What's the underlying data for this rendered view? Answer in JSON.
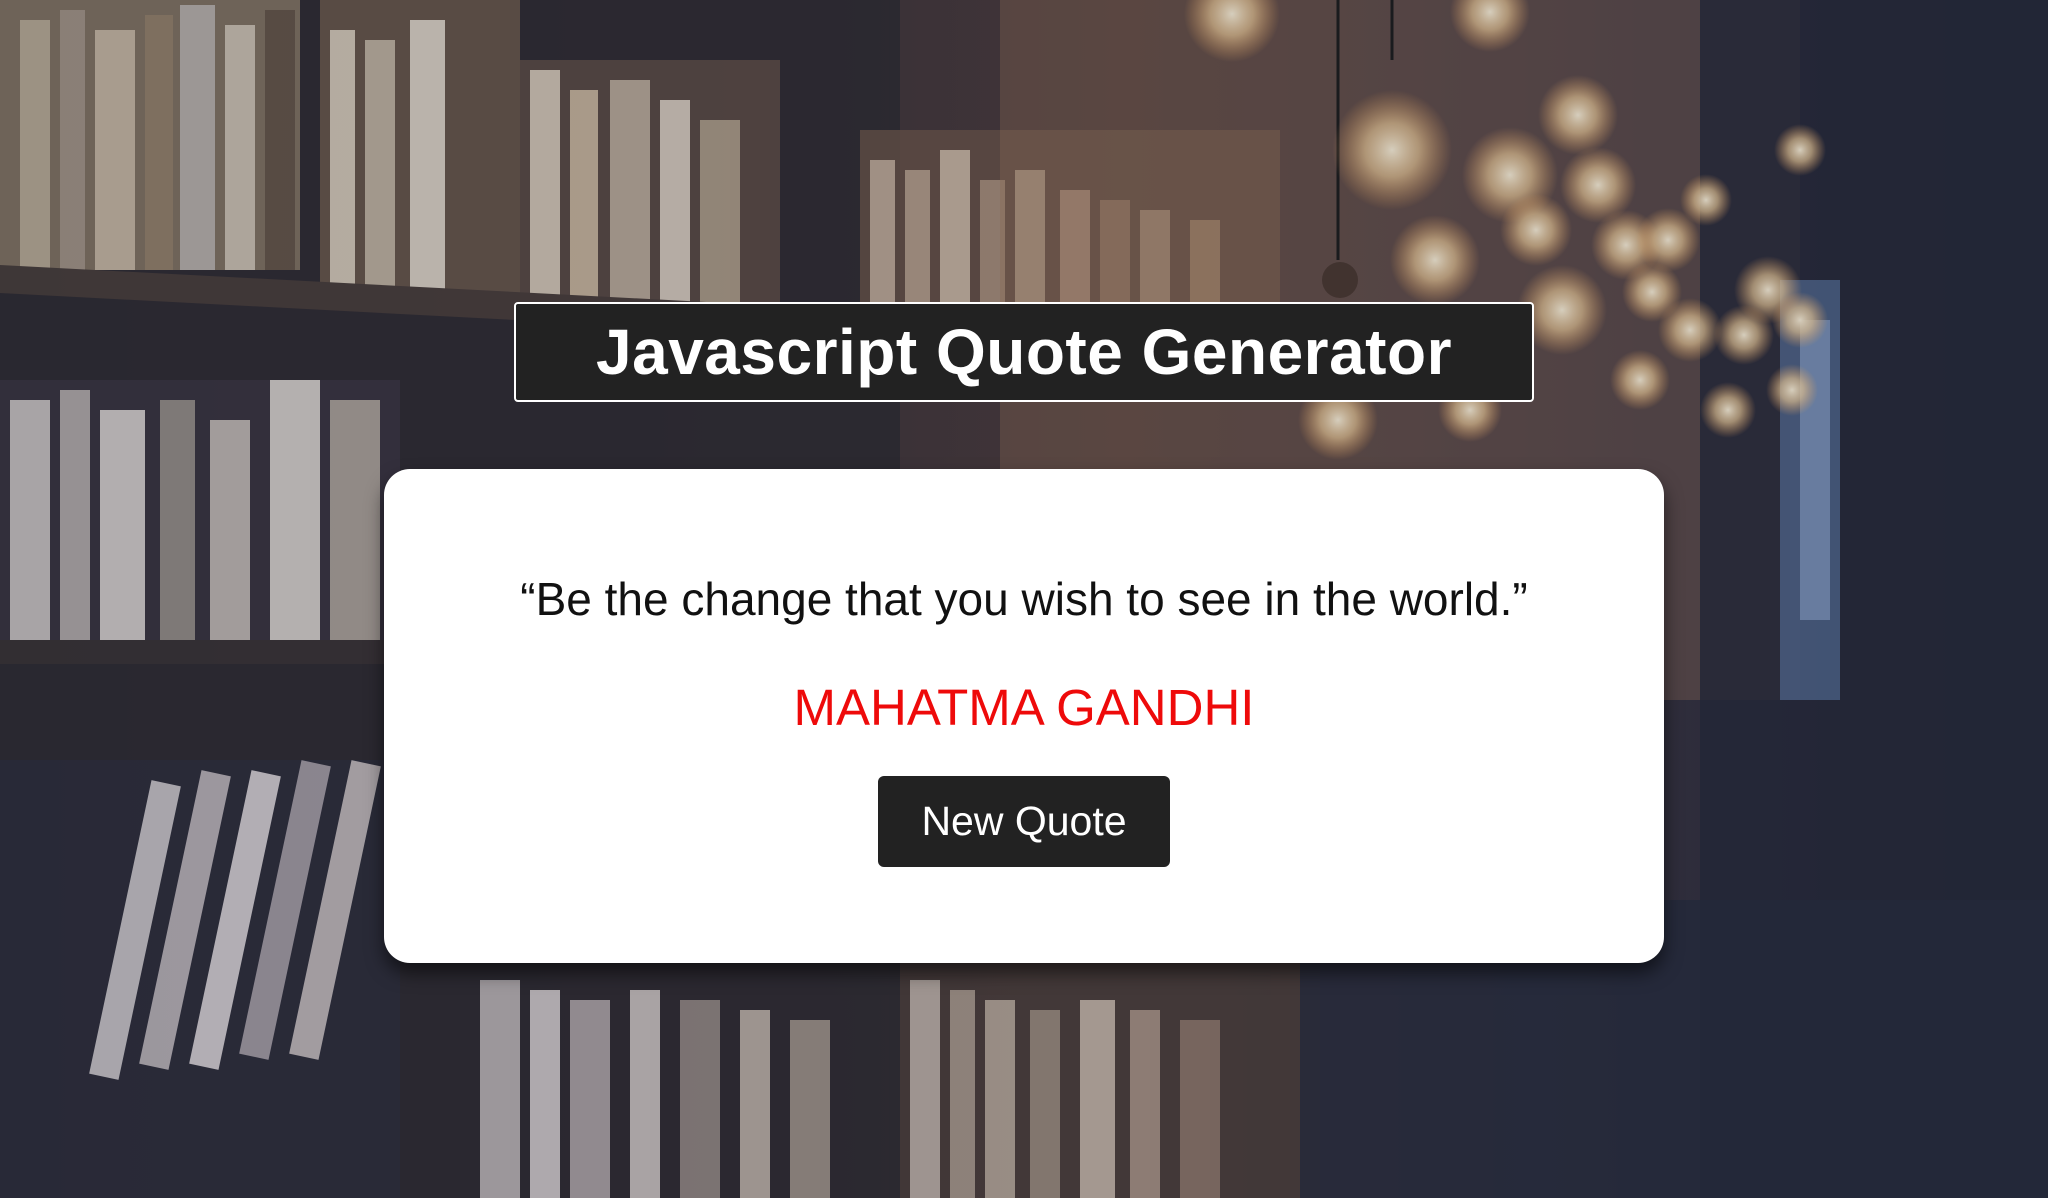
{
  "header": {
    "title": "Javascript Quote Generator"
  },
  "quote_card": {
    "quote_text": "“Be the change that you wish to see in the world.”",
    "author": "MAHATMA GANDHI",
    "new_quote_label": "New Quote"
  },
  "background": {
    "image": "library-bookshelves-with-hanging-light-bulbs"
  },
  "colors": {
    "title_bg": "#222222",
    "button_bg": "#222222",
    "author_text": "#ee0a0a",
    "card_bg": "#ffffff"
  }
}
